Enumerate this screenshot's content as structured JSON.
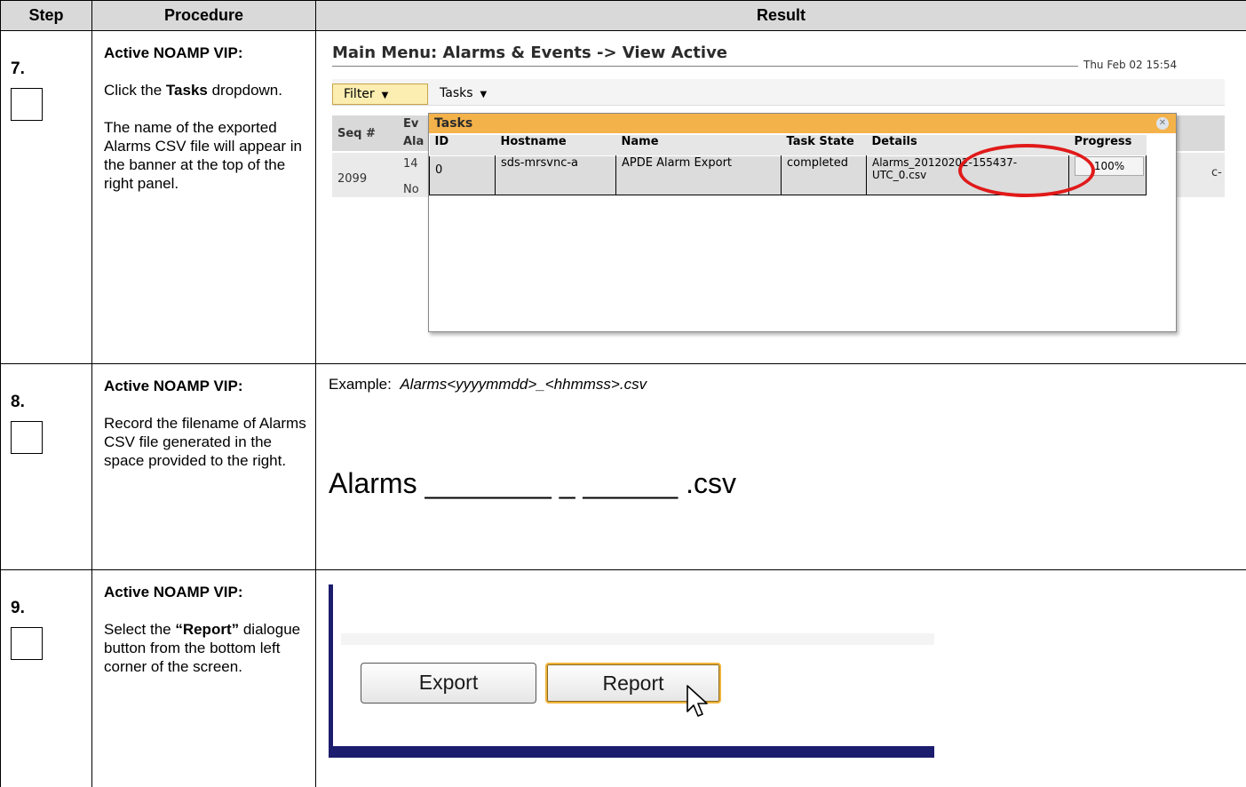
{
  "headers": {
    "step": "Step",
    "procedure": "Procedure",
    "result": "Result"
  },
  "steps": [
    {
      "number": "7.",
      "procedure": {
        "heading": "Active NOAMP VIP:",
        "p1_before": "Click the ",
        "p1_bold": "Tasks",
        "p1_after": " dropdown.",
        "p2": "The name of the exported Alarms CSV file will appear in the banner at the top of the right panel."
      },
      "screenshot": {
        "menu_title": "Main Menu: Alarms & Events -> View Active",
        "datetime": "Thu Feb 02 15:54",
        "filter_label": "Filter",
        "tasks_label": "Tasks",
        "bg_seq_header": "Seq #",
        "bg_ev": "Ev",
        "bg_ala": "Ala",
        "bg_seq_value": "2099",
        "bg_14": "14",
        "bg_no": "No",
        "bg_c": "c-",
        "popup": {
          "title": "Tasks",
          "close_icon": "close-icon",
          "columns": [
            "ID",
            "Hostname",
            "Name",
            "Task State",
            "Details",
            "Progress"
          ],
          "row": {
            "id": "0",
            "hostname": "sds-mrsvnc-a",
            "name": "APDE Alarm Export",
            "state": "completed",
            "details_line1": "Alarms_20120202-155437-",
            "details_line2": "UTC_0.csv",
            "progress": "100%"
          }
        }
      }
    },
    {
      "number": "8.",
      "procedure": {
        "heading": "Active NOAMP VIP:",
        "p1": "Record the filename of Alarms CSV file generated in the space provided to the right."
      },
      "result": {
        "example_label": "Example:",
        "example_value": "Alarms<yyyymmdd>_<hhmmss>.csv",
        "filename_template": "Alarms ________ _ ______ .csv"
      }
    },
    {
      "number": "9.",
      "procedure": {
        "heading": "Active NOAMP VIP:",
        "p1_before": "Select the ",
        "p1_bold": "“Report”",
        "p1_after": " dialogue button from the bottom left corner of the screen."
      },
      "screenshot": {
        "export_label": "Export",
        "report_label": "Report",
        "cursor_icon": "arrow-cursor-icon"
      }
    }
  ],
  "colors": {
    "header_bg": "#d9d9d9",
    "popup_title_bg": "#f3b24a",
    "highlight_circle": "#e11a1a",
    "frame_navy": "#1c1d6e"
  }
}
